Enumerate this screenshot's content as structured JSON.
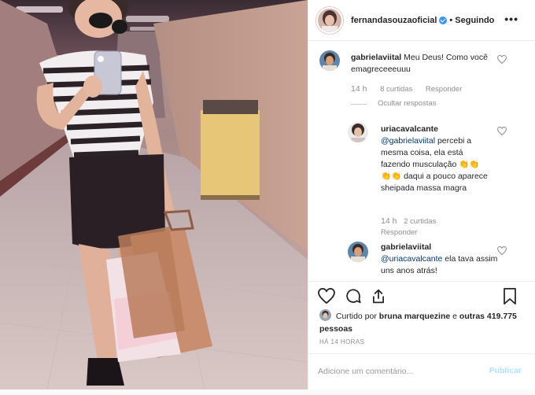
{
  "post": {
    "username": "fernandasouzaoficial",
    "follow_state": "Seguindo",
    "more_icon": "more-options-icon",
    "verified_icon": "verified-badge-icon"
  },
  "comments": [
    {
      "username": "gabrielaviital",
      "text": "Meu Deus! Como você emagreceeeuuu",
      "time": "14 h",
      "likes": "8 curtidas",
      "reply": "Responder",
      "hide_replies": "Ocultar respostas"
    },
    {
      "username": "uriacavalcante",
      "mention": "@gabrielaviital",
      "text": "percebi a mesma coisa, ela está fazendo musculação 👏👏 👏👏 daqui a pouco aparece sheipada massa magra",
      "time": "14 h",
      "likes": "2 curtidas",
      "reply": "Responder"
    },
    {
      "username": "gabrielaviital",
      "mention": "@uriacavalcante",
      "text": "ela tava assim uns anos atrás!"
    }
  ],
  "likes": {
    "prefix": "Curtido por",
    "first_liker": "bruna marquezine",
    "conj": "e",
    "others": "outras 419.775 pessoas"
  },
  "date": "HÁ 14 HORAS",
  "add_comment": {
    "placeholder": "Adicione um comentário...",
    "post_label": "Publicar"
  },
  "icons": {
    "like": "heart-icon",
    "comment": "comment-icon",
    "share": "share-icon",
    "save": "bookmark-icon"
  },
  "colors": {
    "link": "#00376b",
    "verified": "#3897f0",
    "muted": "#8e8e8e",
    "publish_disabled": "#b2dffc"
  }
}
